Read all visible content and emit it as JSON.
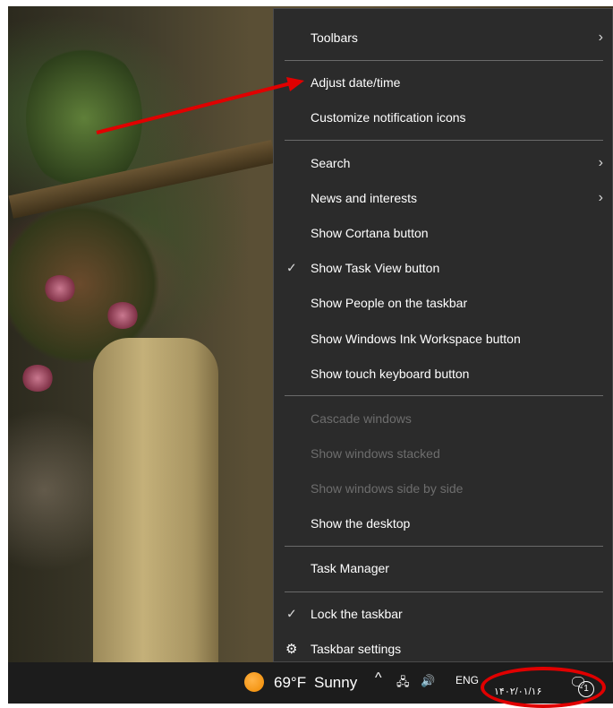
{
  "menu": {
    "items": [
      {
        "label": "Toolbars",
        "submenu": true
      },
      {
        "label": "Adjust date/time"
      },
      {
        "label": "Customize notification icons"
      },
      {
        "label": "Search",
        "submenu": true
      },
      {
        "label": "News and interests",
        "submenu": true
      },
      {
        "label": "Show Cortana button"
      },
      {
        "label": "Show Task View button",
        "checked": true
      },
      {
        "label": "Show People on the taskbar"
      },
      {
        "label": "Show Windows Ink Workspace button"
      },
      {
        "label": "Show touch keyboard button"
      },
      {
        "label": "Cascade windows",
        "disabled": true
      },
      {
        "label": "Show windows stacked",
        "disabled": true
      },
      {
        "label": "Show windows side by side",
        "disabled": true
      },
      {
        "label": "Show the desktop"
      },
      {
        "label": "Task Manager"
      },
      {
        "label": "Lock the taskbar",
        "checked": true
      },
      {
        "label": "Taskbar settings",
        "icon": "gear-icon"
      }
    ],
    "check_glyph": "✓",
    "chevron_glyph": "›",
    "gear_glyph": "⚙"
  },
  "taskbar": {
    "temperature": "69°F",
    "weather": "Sunny",
    "overflow_caret": "^",
    "network_icon": "network-icon",
    "volume_icon": "volume-icon",
    "language": "ENG",
    "date": "۱۴۰۲/۰۱/۱۶",
    "notification_icon": "notification-icon",
    "badge": "1"
  },
  "colors": {
    "menu_bg": "#2b2b2b",
    "menu_text": "#ffffff",
    "menu_disabled": "#6d6d6d",
    "taskbar_bg": "#1c1c1c",
    "annotation": "#e00000"
  }
}
